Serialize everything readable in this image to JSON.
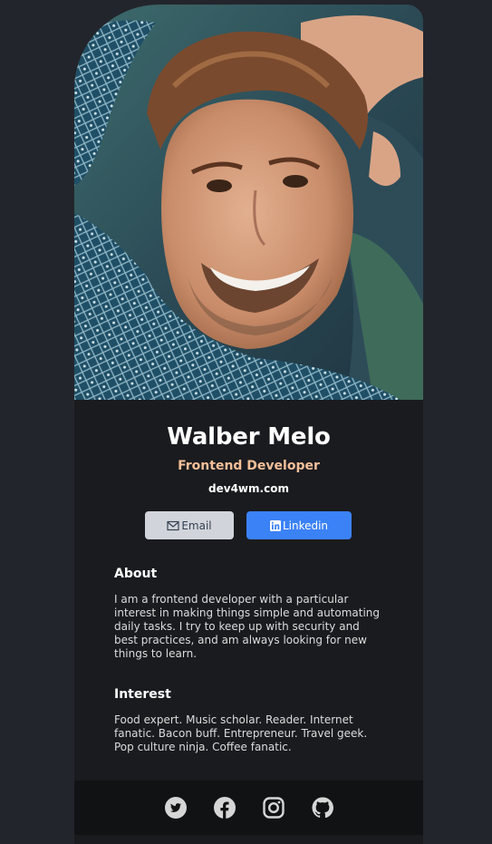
{
  "profile": {
    "name": "Walber Melo",
    "role": "Frontend Developer",
    "website": "dev4wm.com"
  },
  "buttons": {
    "email_label": "Email",
    "linkedin_label": "Linkedin"
  },
  "about": {
    "title": "About",
    "text": "I am a frontend developer with a particular interest in making things simple and automating daily tasks. I try to keep up with security and best practices, and am always looking for new things to learn."
  },
  "interest": {
    "title": "Interest",
    "text": "Food expert. Music scholar. Reader. Internet fanatic. Bacon buff. Entrepreneur. Travel geek. Pop culture ninja. Coffee fanatic."
  },
  "footer": {
    "icons": [
      "twitter-icon",
      "facebook-icon",
      "instagram-icon",
      "github-icon"
    ]
  },
  "colors": {
    "page_bg": "#23252c",
    "card_bg": "#1a1b1f",
    "footer_bg": "#111214",
    "accent_orange": "#f3bf99",
    "linkedin_blue": "#3b82f6",
    "email_gray": "#d1d5db"
  }
}
